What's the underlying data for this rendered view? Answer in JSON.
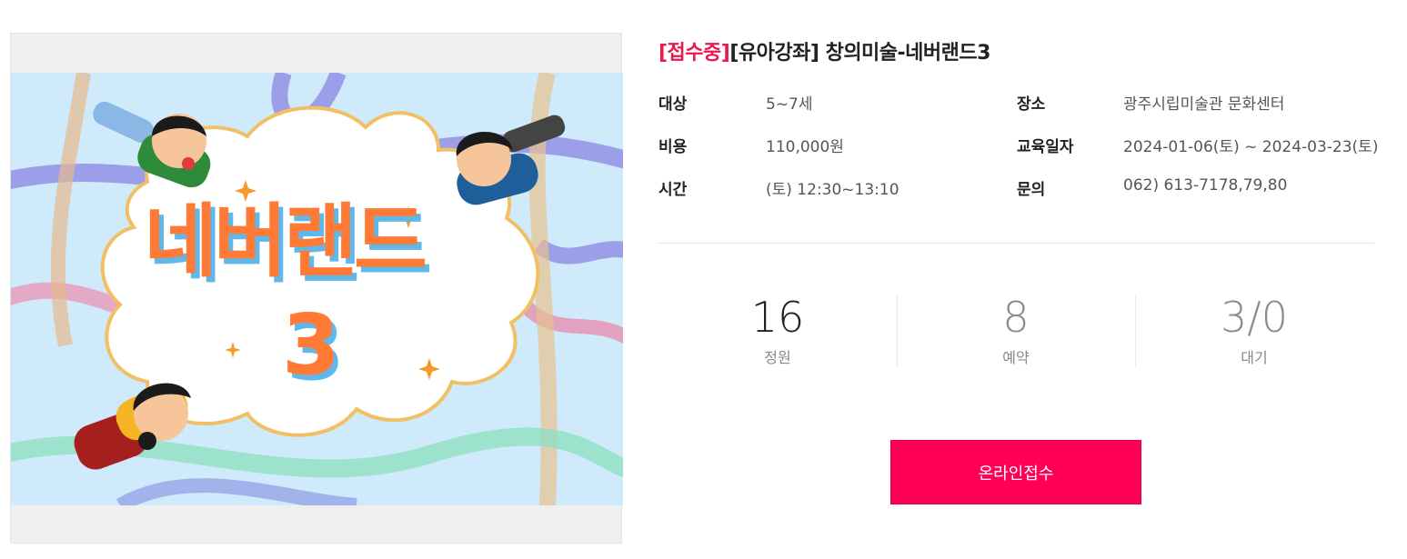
{
  "poster": {
    "title": "네버랜드",
    "number": "3"
  },
  "course": {
    "status": "[접수중]",
    "title": "[유아강좌] 창의미술-네버랜드3"
  },
  "info": [
    {
      "label": "대상",
      "value": "5~7세"
    },
    {
      "label": "장소",
      "value": "광주시립미술관 문화센터"
    },
    {
      "label": "비용",
      "value": "110,000원"
    },
    {
      "label": "교육일자",
      "value": "2024-01-06(토) ~ 2024-03-23(토)"
    },
    {
      "label": "시간",
      "value": "(토) 12:30~13:10"
    },
    {
      "label": "문의",
      "value": "062) 613-7178,79,80"
    }
  ],
  "stats": [
    {
      "value": "16",
      "label": "정원"
    },
    {
      "value": "8",
      "label": "예약"
    },
    {
      "value": "3/0",
      "label": "대기"
    }
  ],
  "apply_button": "온라인접수",
  "colors": {
    "status": "#e8194f",
    "apply_button": "#ff0055",
    "poster_title": "#ff7a35",
    "poster_background": "#cfeafa"
  }
}
